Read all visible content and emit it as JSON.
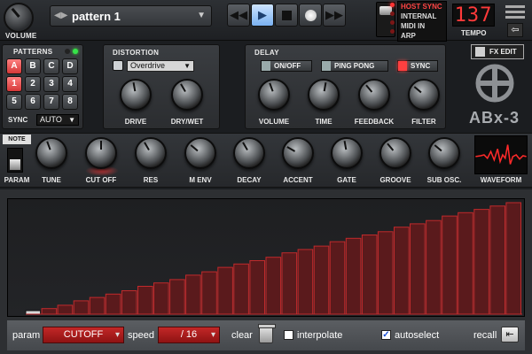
{
  "volume": {
    "label": "VOLUME"
  },
  "pattern": {
    "name": "pattern 1"
  },
  "transport": {
    "rewind_icon": "rewind-icon",
    "play_icon": "play-icon",
    "stop_icon": "stop-icon",
    "record_icon": "record-icon",
    "forward_icon": "fast-forward-icon",
    "play_active": true
  },
  "sync_modes": [
    "HOST SYNC",
    "INTERNAL",
    "MIDI IN",
    "ARP"
  ],
  "sync_selected": "HOST SYNC",
  "tempo": {
    "value": "137",
    "label": "TEMPO"
  },
  "patterns": {
    "title": "PATTERNS",
    "letters": [
      "A",
      "B",
      "C",
      "D"
    ],
    "numbers": [
      "1",
      "2",
      "3",
      "4",
      "5",
      "6",
      "7",
      "8"
    ],
    "active_letter": "A",
    "active_number": "1",
    "sync_label": "SYNC",
    "sync_value": "AUTO"
  },
  "distortion": {
    "title": "DISTORTION",
    "type": "Overdrive",
    "knobs": [
      "DRIVE",
      "DRY/WET"
    ]
  },
  "delay": {
    "title": "DELAY",
    "toggles": {
      "onoff": "ON/OFF",
      "pingpong": "PING PONG",
      "sync": "SYNC"
    },
    "sync_on": true,
    "knobs": [
      "VOLUME",
      "TIME",
      "FEEDBACK",
      "FILTER"
    ]
  },
  "fx_edit": "FX EDIT",
  "logo": "ABx-3",
  "note_button": "NOTE",
  "param_knobs": [
    "PARAM",
    "TUNE",
    "CUT OFF",
    "RES",
    "M ENV",
    "DECAY",
    "ACCENT",
    "GATE",
    "GROOVE",
    "SUB OSC.",
    "WAVEFORM"
  ],
  "accent_color": "#d42a2a",
  "editor": {
    "param_label": "param",
    "param_value": "CUTOFF",
    "speed_label": "speed",
    "speed_value": "/ 16",
    "clear_label": "clear",
    "interpolate_label": "interpolate",
    "interpolate_checked": false,
    "autoselect_label": "autoselect",
    "autoselect_checked": true,
    "recall_label": "recall",
    "recall_icon": "return-arrow-icon",
    "step_values": [
      0.0,
      0.05,
      0.08,
      0.12,
      0.15,
      0.18,
      0.21,
      0.25,
      0.28,
      0.31,
      0.35,
      0.38,
      0.42,
      0.45,
      0.48,
      0.51,
      0.55,
      0.58,
      0.61,
      0.65,
      0.68,
      0.71,
      0.74,
      0.78,
      0.81,
      0.84,
      0.88,
      0.91,
      0.94,
      0.97,
      1.0
    ]
  }
}
